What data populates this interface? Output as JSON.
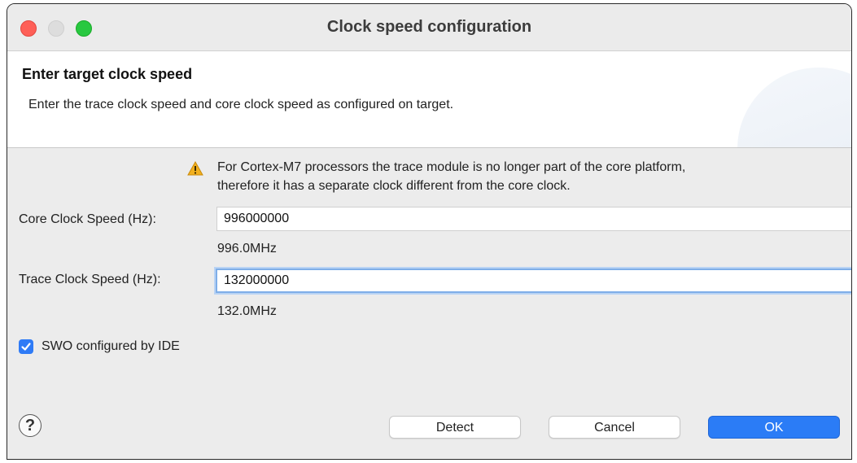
{
  "window": {
    "title": "Clock speed configuration"
  },
  "banner": {
    "heading": "Enter target clock speed",
    "description": "Enter the trace clock speed and core clock speed as configured on target."
  },
  "warning": {
    "icon": "warning-icon",
    "line1": "For Cortex-M7 processors the trace module is no longer part of the core platform,",
    "line2": "therefore it has a separate clock different from the core clock."
  },
  "core_clock": {
    "label": "Core Clock Speed (Hz):",
    "value": "996000000",
    "hint": "996.0MHz"
  },
  "trace_clock": {
    "label": "Trace Clock Speed (Hz):",
    "value": "132000000",
    "hint": "132.0MHz"
  },
  "swo": {
    "label": "SWO configured by IDE",
    "checked": true
  },
  "buttons": {
    "help": "?",
    "detect": "Detect",
    "cancel": "Cancel",
    "ok": "OK"
  },
  "colors": {
    "accent": "#2b7cf6",
    "close": "#fe5f57",
    "maximize": "#28c840",
    "warning": "#f2b01e"
  }
}
